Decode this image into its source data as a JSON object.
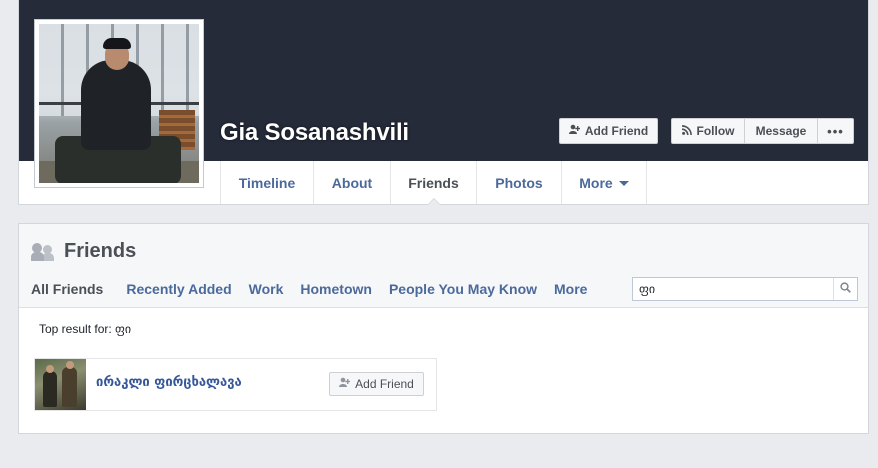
{
  "profile": {
    "name": "Gia Sosanashvili",
    "photo_icon": "profile-photo"
  },
  "actions": {
    "add_friend": "Add Friend",
    "follow": "Follow",
    "message": "Message",
    "more": "•••"
  },
  "tabs": [
    {
      "label": "Timeline"
    },
    {
      "label": "About"
    },
    {
      "label": "Friends",
      "active": true
    },
    {
      "label": "Photos"
    },
    {
      "label": "More"
    }
  ],
  "friends": {
    "title": "Friends",
    "subnav": [
      {
        "label": "All Friends",
        "active": true
      },
      {
        "label": "Recently Added"
      },
      {
        "label": "Work"
      },
      {
        "label": "Hometown"
      },
      {
        "label": "People You May Know"
      },
      {
        "label": "More"
      }
    ],
    "search": {
      "value": "ფი",
      "placeholder": ""
    },
    "top_result_label": "Top result for: ფი",
    "results": [
      {
        "name": "ირაკლი ფირცხალავა",
        "action": "Add Friend"
      }
    ]
  },
  "colors": {
    "cover": "#262b3a",
    "link": "#4b6a9b",
    "background": "#e9ebee"
  }
}
